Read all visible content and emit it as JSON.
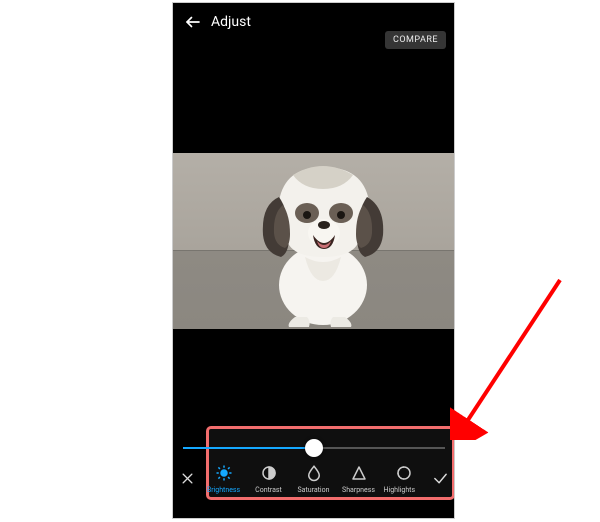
{
  "header": {
    "title": "Adjust"
  },
  "compare_label": "COMPARE",
  "slider": {
    "value": 50,
    "min": 0,
    "max": 100
  },
  "active_tool": "brightness",
  "tools": [
    {
      "id": "brightness",
      "label": "Brightness",
      "icon": "brightness-icon"
    },
    {
      "id": "contrast",
      "label": "Contrast",
      "icon": "contrast-icon"
    },
    {
      "id": "saturation",
      "label": "Saturation",
      "icon": "saturation-icon"
    },
    {
      "id": "sharpness",
      "label": "Sharpness",
      "icon": "sharpness-icon"
    },
    {
      "id": "highlights",
      "label": "Highlights",
      "icon": "highlights-icon"
    }
  ],
  "accent_color": "#15a8ff",
  "annotation": {
    "highlight_color": "#f26d6d",
    "arrow_color": "#ff0000"
  }
}
